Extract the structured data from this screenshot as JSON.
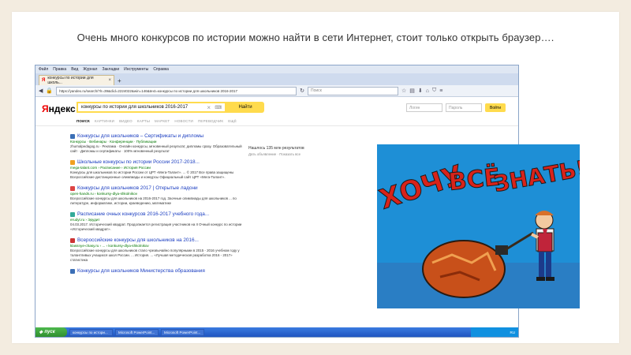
{
  "caption": "Очень много конкурсов по истории можно найти в сети Интернет, стоит только открыть браузер….",
  "browser": {
    "menu": [
      "Файл",
      "Правка",
      "Вид",
      "Журнал",
      "Закладки",
      "Инструменты",
      "Справка"
    ],
    "tab_label": "конкурсы по истории для школь...",
    "url": "https://yandex.ru/search/?lr=39&clid=2224022&win=146&text=конкурсы по истории для школьников 2016-2017",
    "find_placeholder": "Поиск"
  },
  "yandex": {
    "logo": {
      "main": "Я",
      "rest": "ндекс"
    },
    "query": "конкурсы по истории для школьников 2016-2017",
    "find_button": "Найти",
    "login_placeholder": "Логин",
    "password_placeholder": "Пароль",
    "login_button": "Войти",
    "tabs": [
      "ПОИСК",
      "КАРТИНКИ",
      "ВИДЕО",
      "КАРТЫ",
      "МАРКЕТ",
      "НОВОСТИ",
      "ПЕРЕВОДЧИК",
      "ЕЩЁ"
    ],
    "stats": "Нашлось 135 млн результатов",
    "stats_links": "Дать объявление · Показать все",
    "results": [
      {
        "title": "Конкурсы для школьников – Сертификаты и дипломы",
        "link": "Конкурсы · Вебинары · Конференции · Публикации",
        "snippet": "zhurnalpedagog.ru · Реклама · Онлайн конкурсы, мгновенный результат, дипломы сразу. Образовательный сайт · Дипломы и сертификаты · 100% мгновенный результат"
      },
      {
        "title": "Школьные конкурсы по истории России 2017-2018...",
        "link": "mega-talant.com › Расписание › История России",
        "snippet": "Конкурсы для школьников по истории России от ЦРТ «Мега-Талант». ... © 2017 Все права защищены Всероссийские дистанционные олимпиады и конкурсы Официальный сайт ЦРТ «Мега-Талант»."
      },
      {
        "title": "Конкурсы для школьников 2017 | Открытые ладони",
        "link": "open-hands.ru › konkursy-dlya-shkolnikov",
        "snippet": "Всероссийские конкурсы для школьников на 2016-2017 год. Заочные олимпиады для школьников ... по литературе, информатике, истории, краеведению, математике"
      },
      {
        "title": "Расписание очных конкурсов 2016-2017 учебного года...",
        "link": "erudyt.ru › Эрудит",
        "snippet": "04.03.2017. Исторический квадрат. Продолжается регистрация участников на II Очный конкурс по истории «Исторический квадрат»."
      },
      {
        "title": "Всероссийские конкурсы для школьников на 2016...",
        "link": "klassnye-chasy.ru › ... › konkursy-dlya-shkolnikov",
        "snippet": "Всероссийские конкурсы для школьников стало чрезвычайно популярными в 2015 - 2016 учебном году у талантливых учащихся школ России. ... История. ... «Лучшая методическая разработка 2016 - 2017» статистика"
      },
      {
        "title": "Конкурсы для школьников Министерства образования",
        "link": "",
        "snippet": ""
      }
    ]
  },
  "taskbar": {
    "start": "пуск",
    "items": [
      "конкурсы по истори...",
      "Microsoft PowerPoint...",
      "Microsoft PowerPoint..."
    ],
    "clock": "RU"
  },
  "poster": {
    "words": [
      "ХОЧУ",
      "ВСЁ",
      "ЗНАТЬ!"
    ],
    "colors": {
      "background": "#1e8fd6",
      "text": "#d8231a"
    }
  }
}
